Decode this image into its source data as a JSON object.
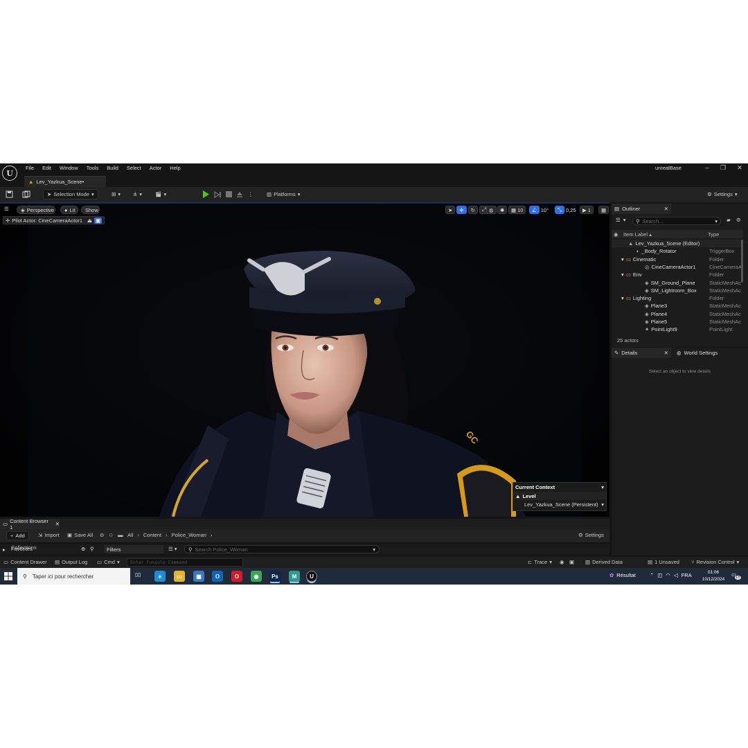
{
  "app": {
    "project_name": "unrealBase",
    "menu": [
      "File",
      "Edit",
      "Window",
      "Tools",
      "Build",
      "Select",
      "Actor",
      "Help"
    ],
    "logo_glyph": "U",
    "tab_title": "Lev_Yazkua_Scene•"
  },
  "toolbar": {
    "selection_mode": "Selection Mode",
    "platforms": "Platforms",
    "settings": "Settings"
  },
  "viewport": {
    "perspective": "Perspective",
    "lit": "Lit",
    "show": "Show",
    "pilot_actor": "Pilot Actor: CineCameraActor1",
    "grid_snap": "10",
    "rotation_snap": "10°",
    "scale_snap": "0,25",
    "camera_speed": "1",
    "badge_text": "GC",
    "context": {
      "title": "Current Context",
      "label": "Level",
      "value": "Lev_Yazkua_Scene (Persistent)"
    }
  },
  "outliner": {
    "tab": "Outliner",
    "search_placeholder": "Search...",
    "col_label": "Item Label",
    "col_type": "Type",
    "items": [
      {
        "label": "Lev_Yazkua_Scene (Editor)",
        "type": "",
        "icon": "level-icon"
      },
      {
        "label": "_Body_Rotator",
        "type": "TriggerBox",
        "icon": "trigger-icon"
      },
      {
        "label": "Cinematic",
        "type": "Folder",
        "icon": "folder-icon"
      },
      {
        "label": "CineCameraActor1",
        "type": "CineCameraA",
        "icon": "camera-icon"
      },
      {
        "label": "Env",
        "type": "Folder",
        "icon": "folder-icon"
      },
      {
        "label": "SM_Ground_Plane",
        "type": "StaticMeshAc",
        "icon": "mesh-icon"
      },
      {
        "label": "SM_Lightroom_Box",
        "type": "StaticMeshAc",
        "icon": "mesh-icon"
      },
      {
        "label": "Lighting",
        "type": "Folder",
        "icon": "folder-icon"
      },
      {
        "label": "Plane3",
        "type": "StaticMeshAc",
        "icon": "mesh-icon"
      },
      {
        "label": "Plane4",
        "type": "StaticMeshAc",
        "icon": "mesh-icon"
      },
      {
        "label": "Plane5",
        "type": "StaticMeshAc",
        "icon": "mesh-icon"
      },
      {
        "label": "PointLight9",
        "type": "PointLight",
        "icon": "light-icon"
      }
    ],
    "count": "25 actors"
  },
  "details": {
    "tab": "Details",
    "world_settings_tab": "World Settings",
    "empty": "Select an object to view details"
  },
  "content_browser": {
    "tab": "Content Browser 1",
    "add": "Add",
    "import": "Import",
    "save_all": "Save All",
    "path": [
      "All",
      "Content",
      "Police_Woman"
    ],
    "settings": "Settings",
    "favorites": "Favorites",
    "collections": "Collections",
    "filters": "Filters",
    "search_placeholder": "Search Police_Woman"
  },
  "statusbar": {
    "content_drawer": "Content Drawer",
    "output_log": "Output Log",
    "cmd": "Cmd",
    "console_placeholder": "Enter Console Command",
    "trace": "Trace",
    "derived_data": "Derived Data",
    "unsaved": "1 Unsaved",
    "revision_control": "Revision Control"
  },
  "taskbar": {
    "search_placeholder": "Taper ici pour rechercher",
    "result": "Résultat",
    "lang": "FRA",
    "time": "01:06",
    "date": "10/12/2024",
    "notif_count": "15",
    "apps": [
      {
        "name": "edge-icon",
        "glyph": "e",
        "color": "#1f8ad6"
      },
      {
        "name": "explorer-icon",
        "glyph": "▭",
        "color": "#e8b330"
      },
      {
        "name": "store-icon",
        "glyph": "▦",
        "color": "#3a78c9"
      },
      {
        "name": "outlook-icon",
        "glyph": "O",
        "color": "#0f63b8"
      },
      {
        "name": "opera-icon",
        "glyph": "O",
        "color": "#d21b27"
      },
      {
        "name": "chrome-icon",
        "glyph": "◉",
        "color": "#3aa757"
      },
      {
        "name": "photoshop-icon",
        "glyph": "Ps",
        "color": "#0b2a4a"
      },
      {
        "name": "app-m-icon",
        "glyph": "M",
        "color": "#2f9a8f"
      },
      {
        "name": "unreal-icon",
        "glyph": "U",
        "color": "#111111"
      }
    ]
  },
  "colors": {
    "accent_blue": "#2f6fe8",
    "play_green": "#52c41a",
    "editor_bg": "#151515"
  }
}
